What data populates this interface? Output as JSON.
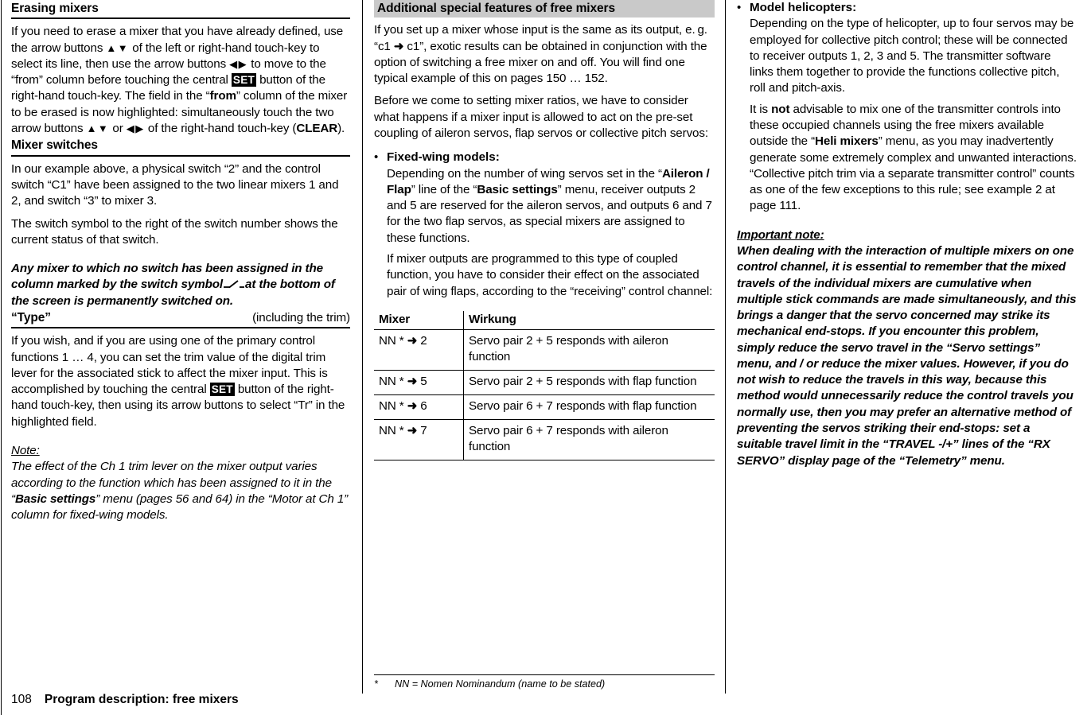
{
  "page": {
    "number": "108",
    "footer_title": "Program description: free mixers"
  },
  "left_column": {
    "heading_erasing": "Erasing mixers",
    "erasing_p1_a": "If you need to erase a mixer that you have already defined, use the arrow buttons ",
    "erasing_p1_b": " of the left or right-hand touch-key to select its line, then use the arrow buttons ",
    "erasing_p1_c": " to move to the “from” column before touching the central ",
    "set_key": "SET",
    "erasing_p1_d": " button of the right-hand touch-key. The field in the “",
    "erasing_from": "from",
    "erasing_p1_e": "” column of the mixer to be erased is now highlighted: simultaneously touch the two arrow buttons ",
    "erasing_p1_f": " or ",
    "erasing_p1_g": " of the right-hand touch-key (",
    "clear_key": "CLEAR",
    "erasing_p1_h": ").",
    "heading_switches": "Mixer switches",
    "switches_p1": "In our example above, a physical switch “2” and the control switch “C1” have been assigned to the two linear mixers 1 and 2, and switch “3” to mixer 3.",
    "switches_p2": "The switch symbol to the right of the switch number shows the current status of that switch.",
    "switches_p3_a": "Any mixer to which no switch has been assigned in the column marked by the switch symbol",
    "switches_p3_b": "at the bottom of the screen is permanently switched on.",
    "heading_type": "“Type”",
    "heading_type_right": "(including the trim)",
    "type_p1_a": "If you wish, and if you are using one of the primary control functions 1 … 4, you can set the trim value of the digital trim lever for the associated stick to affect the mixer input. This is accomplished by touching the central ",
    "type_p1_b": " button of the right-hand touch-key, then using its arrow buttons to select “Tr” in the highlighted field.",
    "note_label": "Note:",
    "note_a": "The effect of the Ch 1 trim lever on the mixer output varies according to the function which has been assigned to it in the “",
    "note_bold": "Basic settings",
    "note_b": "” menu (pages 56 and 64) in the “Motor at Ch 1” column for fixed-wing models."
  },
  "middle_column": {
    "heading": "Additional special features of free mixers",
    "p1_a": "If you set up a mixer whose input is the same as its output, e. g. “c1 ",
    "p1_arrow": "➜",
    "p1_b": " c1”, exotic results can be obtained in conjunction with the option of switching a free mixer on and off. You will find one typical example of this on pages 150 … 152.",
    "p2": "Before we come to setting mixer ratios, we have to consider what happens if a mixer input is allowed to act on the pre-set coupling of aileron servos, flap servos or collective pitch servos:",
    "bullet_dot": "•",
    "bullet_title": "Fixed-wing models:",
    "bullet_p1_a": "Depending on the number of wing servos set in the “",
    "bullet_p1_bold1": "Aileron / Flap",
    "bullet_p1_b": "” line of the “",
    "bullet_p1_bold2": "Basic settings",
    "bullet_p1_c": "” menu, receiver outputs 2 and 5 are reserved for the aileron servos, and outputs 6 and 7 for the two flap servos, as special mixers are assigned to these functions.",
    "bullet_p2": "If mixer outputs are programmed to this type of coupled function, you have to consider their effect on the associated pair of wing flaps, according to the “receiving” control channel:",
    "table": {
      "headers": [
        "Mixer",
        "Wirkung"
      ],
      "rows": [
        {
          "mixer_pre": "NN *",
          "arrow": "➜",
          "mixer_post": "2",
          "effect": "Servo pair 2 + 5 responds with aileron function"
        },
        {
          "mixer_pre": "NN *",
          "arrow": "➜",
          "mixer_post": "5",
          "effect": "Servo pair 2 + 5 responds with flap function"
        },
        {
          "mixer_pre": "NN *",
          "arrow": "➜",
          "mixer_post": "6",
          "effect": "Servo pair 6 + 7 responds with flap function"
        },
        {
          "mixer_pre": "NN *",
          "arrow": "➜",
          "mixer_post": "7",
          "effect": "Servo pair 6 + 7 responds with aileron function"
        }
      ]
    },
    "footnote_mark": "*",
    "footnote_text": "NN = Nomen Nominandum (name to be stated)"
  },
  "right_column": {
    "bullet_dot": "•",
    "bullet_title": "Model helicopters:",
    "bullet_p1": "Depending on the type of helicopter, up to four servos may be employed for collective pitch control; these will be connected to receiver outputs 1, 2, 3 and 5. The transmitter software links them together to provide the functions collective pitch, roll and pitch-axis.",
    "bullet_p2_a": "It is ",
    "bullet_p2_not": "not",
    "bullet_p2_b": " advisable to mix one of the transmitter controls into these occupied channels using the free mixers available outside the “",
    "bullet_p2_bold": "Heli mixers",
    "bullet_p2_c": "” menu, as you may inadvertently generate some extremely complex and unwanted interactions. “Collective pitch trim via a separate transmitter control” counts as one of the few exceptions to this rule; see example 2 at page 111.",
    "important_label": "Important note:",
    "important_text": "When dealing with the interaction of multiple mixers on one control channel, it is essential to remember that the mixed travels of the individual mixers are cumulative when multiple stick commands are made simultaneously, and this brings a danger that the servo concerned may strike its mechanical end-stops. If you encounter this problem, simply reduce the servo travel in the “Servo settings” menu, and / or reduce the mixer values. However, if you do not wish to reduce the travels in this way, because this method would unnecessarily reduce the control travels you normally use, then you may prefer an alternative method of preventing the servos striking their end-stops: set a suitable travel limit in the “TRAVEL -/+” lines of the “RX SERVO” display page of the “Telemetry” menu."
  },
  "icons": {
    "up_down_arrows": "▲▼",
    "left_right_arrows": "◀▶",
    "switch_symbol": "switch-symbol"
  }
}
